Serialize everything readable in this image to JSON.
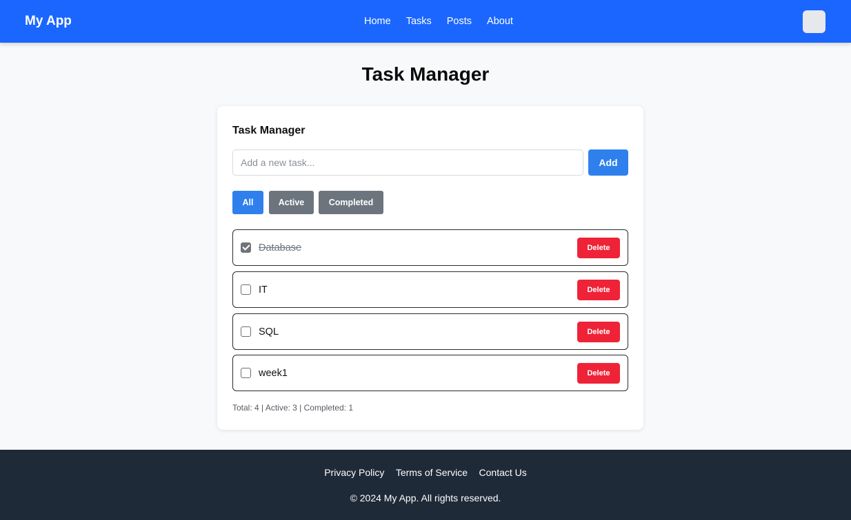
{
  "header": {
    "brand": "My App",
    "nav": [
      "Home",
      "Tasks",
      "Posts",
      "About"
    ]
  },
  "main": {
    "page_title": "Task Manager",
    "card_title": "Task Manager",
    "input_placeholder": "Add a new task...",
    "add_label": "Add",
    "filters": [
      {
        "label": "All",
        "selected": true
      },
      {
        "label": "Active",
        "selected": false
      },
      {
        "label": "Completed",
        "selected": false
      }
    ],
    "tasks": [
      {
        "text": "Database",
        "completed": true,
        "delete_label": "Delete"
      },
      {
        "text": "IT",
        "completed": false,
        "delete_label": "Delete"
      },
      {
        "text": "SQL",
        "completed": false,
        "delete_label": "Delete"
      },
      {
        "text": "week1",
        "completed": false,
        "delete_label": "Delete"
      }
    ],
    "stats": "Total: 4 | Active: 3 | Completed: 1"
  },
  "footer": {
    "links": [
      "Privacy Policy",
      "Terms of Service",
      "Contact Us"
    ],
    "copyright": "© 2024 My App. All rights reserved."
  },
  "colors": {
    "header_bg": "#1a66ff",
    "primary": "#2f80ed",
    "secondary": "#6c757d",
    "danger": "#ef2337",
    "footer_bg": "#1f2a38"
  }
}
